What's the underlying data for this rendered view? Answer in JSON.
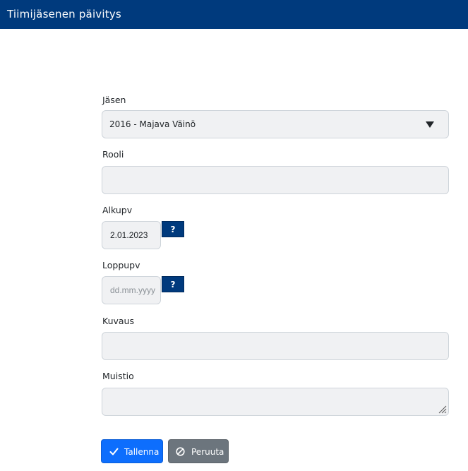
{
  "header": {
    "title": "Tiimijäsenen päivitys"
  },
  "form": {
    "member": {
      "label": "Jäsen",
      "value": "2016 - Majava Väinö"
    },
    "role": {
      "label": "Rooli",
      "value": ""
    },
    "start_date": {
      "label": "Alkupv",
      "value": "2.01.2023",
      "help": "?"
    },
    "end_date": {
      "label": "Loppupv",
      "placeholder": "dd.mm.yyyy",
      "help": "?"
    },
    "description": {
      "label": "Kuvaus",
      "value": ""
    },
    "memo": {
      "label": "Muistio",
      "value": ""
    }
  },
  "actions": {
    "save_label": "Tallenna",
    "cancel_label": "Peruuta"
  },
  "colors": {
    "header_bg": "#003a7d",
    "primary": "#0d6efd",
    "secondary": "#6c757d",
    "field_bg": "#f0f1f3"
  },
  "icons": {
    "save": "check-icon",
    "cancel": "ban-icon",
    "select": "chevron-down-icon",
    "resize": "resize-handle-icon"
  }
}
